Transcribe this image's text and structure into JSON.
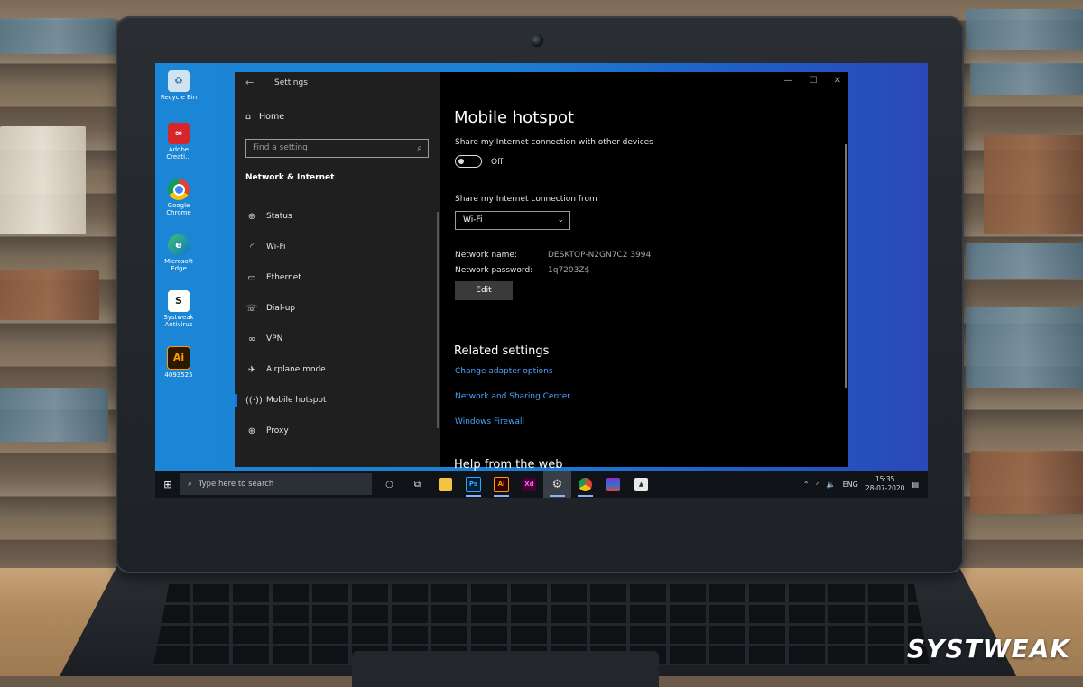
{
  "desktop": {
    "icons": [
      {
        "label": "Recycle Bin",
        "icon": "recycle-bin-icon"
      },
      {
        "label": "Adobe Creati...",
        "icon": "adobe-creative-cloud-icon"
      },
      {
        "label": "Google Chrome",
        "icon": "chrome-icon"
      },
      {
        "label": "Microsoft Edge",
        "icon": "edge-icon"
      },
      {
        "label": "Systweak Antivirus",
        "icon": "systweak-antivirus-icon"
      },
      {
        "label": "4093525",
        "icon": "illustrator-file-icon"
      }
    ]
  },
  "window": {
    "title": "Settings",
    "back_glyph": "←",
    "controls": {
      "minimize": "—",
      "maximize": "☐",
      "close": "✕"
    }
  },
  "nav": {
    "home_label": "Home",
    "search_placeholder": "Find a setting",
    "section_title": "Network & Internet",
    "items": [
      {
        "label": "Status",
        "icon": "globe-icon"
      },
      {
        "label": "Wi-Fi",
        "icon": "wifi-icon"
      },
      {
        "label": "Ethernet",
        "icon": "ethernet-icon"
      },
      {
        "label": "Dial-up",
        "icon": "dialup-icon"
      },
      {
        "label": "VPN",
        "icon": "vpn-icon"
      },
      {
        "label": "Airplane mode",
        "icon": "airplane-icon"
      },
      {
        "label": "Mobile hotspot",
        "icon": "hotspot-icon",
        "active": true
      },
      {
        "label": "Proxy",
        "icon": "globe-icon"
      }
    ]
  },
  "content": {
    "title": "Mobile hotspot",
    "share_label": "Share my Internet connection with other devices",
    "toggle_state": "Off",
    "share_from_label": "Share my Internet connection from",
    "share_from_value": "Wi-Fi",
    "network_name_label": "Network name:",
    "network_name_value": "DESKTOP-N2GN7C2 3994",
    "network_password_label": "Network password:",
    "network_password_value": "1q7203Z$",
    "edit_label": "Edit",
    "related_title": "Related settings",
    "links": [
      "Change adapter options",
      "Network and Sharing Center",
      "Windows Firewall"
    ],
    "help_title": "Help from the web"
  },
  "taskbar": {
    "search_placeholder": "Type here to search",
    "apps": [
      "cortana-icon",
      "task-view-icon",
      "file-explorer-icon",
      "photoshop-icon",
      "illustrator-icon",
      "xd-icon",
      "settings-icon",
      "chrome-icon",
      "winrar-icon",
      "photos-icon"
    ],
    "tray": {
      "language": "ENG",
      "time": "15:35",
      "date": "28-07-2020"
    }
  },
  "watermark": "SYSTWEAK",
  "colors": {
    "accent": "#1a73e8",
    "link": "#4aa3ff",
    "desktop": "#1b86d6"
  }
}
